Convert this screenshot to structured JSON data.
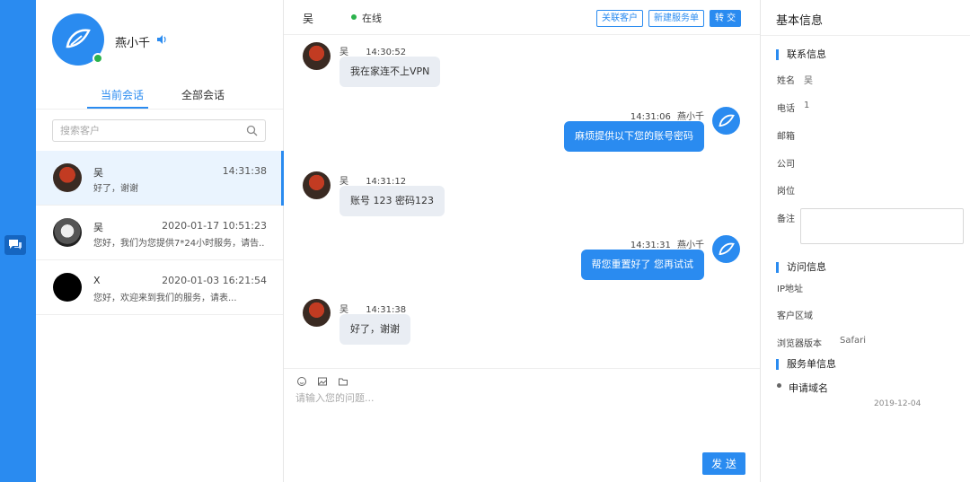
{
  "agent": {
    "name": "燕小千"
  },
  "tabs": {
    "current": "当前会话",
    "all": "全部会话"
  },
  "search": {
    "placeholder": "搜索客户"
  },
  "conversations": [
    {
      "name": "吴",
      "time": "14:31:38",
      "preview": "好了，谢谢",
      "active": true
    },
    {
      "name": "吴",
      "time": "2020-01-17 10:51:23",
      "preview": "您好，我们为您提供7*24小时服务，请告...",
      "active": false
    },
    {
      "name": "X",
      "time": "2020-01-03 16:21:54",
      "preview": "您好，欢迎来到我们的服务，请表...",
      "active": false
    }
  ],
  "chat": {
    "customer_name": "吴",
    "status": "在线",
    "buttons": {
      "link_customer": "关联客户",
      "new_ticket": "新建服务单",
      "transfer": "转 交"
    },
    "messages": [
      {
        "side": "left",
        "sender": "吴",
        "time": "14:30:52",
        "text": "我在家连不上VPN"
      },
      {
        "side": "right",
        "sender": "燕小千",
        "time": "14:31:06",
        "text": "麻烦提供以下您的账号密码"
      },
      {
        "side": "left",
        "sender": "吴",
        "time": "14:31:12",
        "text": "账号 123 密码123"
      },
      {
        "side": "right",
        "sender": "燕小千",
        "time": "14:31:31",
        "text": "帮您重置好了 您再试试"
      },
      {
        "side": "left",
        "sender": "吴",
        "time": "14:31:38",
        "text": "好了，谢谢"
      }
    ],
    "composer_placeholder": "请输入您的问题...",
    "send_label": "发 送"
  },
  "info": {
    "title": "基本信息",
    "contact_section": "联系信息",
    "fields": {
      "name_label": "姓名",
      "name_value": "吴",
      "phone_label": "电话",
      "phone_value": "1",
      "email_label": "邮箱",
      "email_value": "",
      "company_label": "公司",
      "company_value": "",
      "position_label": "岗位",
      "note_label": "备注"
    },
    "visit_section": "访问信息",
    "visit": {
      "ip_label": "IP地址",
      "ip_value": "",
      "region_label": "客户区域",
      "region_value": "",
      "browser_label": "浏览器版本",
      "browser_value": "Safari"
    },
    "ticket_section": "服务单信息",
    "ticket": {
      "label": "申请域名",
      "date": "2019-12-04"
    }
  },
  "colors": {
    "primary": "#2a8bf0",
    "online": "#2bb24c"
  },
  "icons": [
    "chat-icon",
    "bird-logo-icon",
    "speaker-icon",
    "search-icon",
    "emoji-icon",
    "image-icon",
    "folder-icon"
  ]
}
